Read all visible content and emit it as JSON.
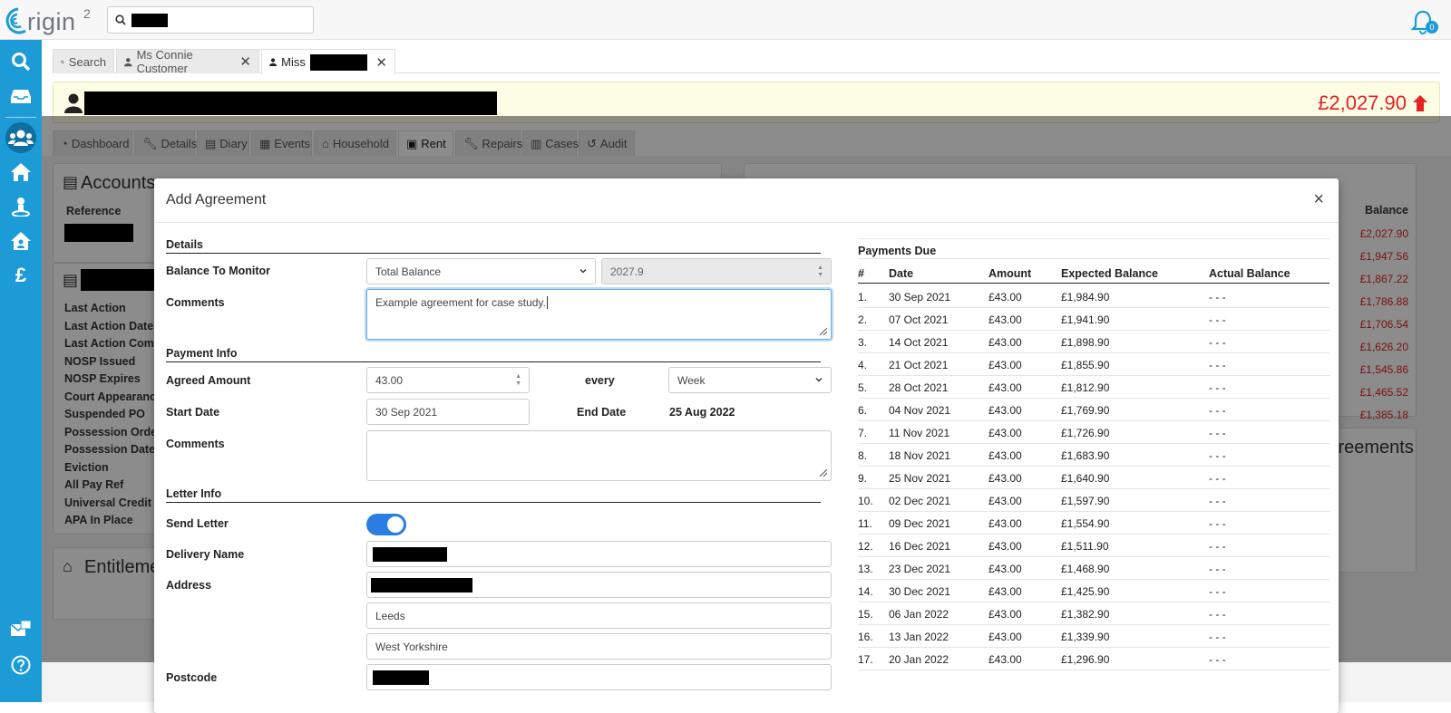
{
  "app": {
    "logo_text": "rigin",
    "logo_sup": "2",
    "notifications_count": "0"
  },
  "tabs": [
    {
      "label": "Search"
    },
    {
      "label": "Ms Connie Customer"
    },
    {
      "label": "Miss"
    }
  ],
  "customer": {
    "balance": "£2,027.90"
  },
  "subtabs": [
    "Dashboard",
    "Details",
    "Diary",
    "Events",
    "Household",
    "Rent",
    "Repairs",
    "Cases",
    "Audit"
  ],
  "background": {
    "accounts_title": "Accounts",
    "reference_label": "Reference",
    "balance_label": "Balance",
    "balances": [
      "£2,027.90",
      "£1,947.56",
      "£1,867.22",
      "£1,786.88",
      "£1,706.54",
      "£1,626.20",
      "£1,545.86",
      "£1,465.52",
      "£1,385.18"
    ],
    "labels": [
      "Last Action",
      "Last Action Date",
      "Last Action Comm",
      "NOSP Issued",
      "NOSP Expires",
      "Court Appearance",
      "Suspended PO",
      "Possession Order",
      "Possession Date",
      "Eviction",
      "All Pay Ref",
      "Universal Credit",
      "APA In Place"
    ],
    "entitlements_title": "Entitleme",
    "agreements_title": "Agreements"
  },
  "modal": {
    "title": "Add Agreement",
    "close": "×",
    "details_heading": "Details",
    "balance_to_monitor_label": "Balance To Monitor",
    "balance_to_monitor_value": "Total Balance",
    "balance_amount": "2027.9",
    "comments_label": "Comments",
    "comments_value": "Example agreement for case study.",
    "payment_info_heading": "Payment Info",
    "agreed_amount_label": "Agreed Amount",
    "agreed_amount_value": "43.00",
    "every_label": "every",
    "frequency_value": "Week",
    "start_date_label": "Start Date",
    "start_date_value": "30 Sep 2021",
    "end_date_label": "End Date",
    "end_date_value": "25 Aug 2022",
    "payment_comments_label": "Comments",
    "payment_comments_value": "",
    "letter_info_heading": "Letter Info",
    "send_letter_label": "Send Letter",
    "send_letter_on": true,
    "delivery_name_label": "Delivery Name",
    "address_label": "Address",
    "address_line3": "Leeds",
    "address_line4": "West Yorkshire",
    "postcode_label": "Postcode"
  },
  "payments": {
    "title": "Payments Due",
    "columns": [
      "#",
      "Date",
      "Amount",
      "Expected Balance",
      "Actual Balance"
    ],
    "rows": [
      [
        "1.",
        "30 Sep 2021",
        "£43.00",
        "£1,984.90",
        "- - -"
      ],
      [
        "2.",
        "07 Oct 2021",
        "£43.00",
        "£1,941.90",
        "- - -"
      ],
      [
        "3.",
        "14 Oct 2021",
        "£43.00",
        "£1,898.90",
        "- - -"
      ],
      [
        "4.",
        "21 Oct 2021",
        "£43.00",
        "£1,855.90",
        "- - -"
      ],
      [
        "5.",
        "28 Oct 2021",
        "£43.00",
        "£1,812.90",
        "- - -"
      ],
      [
        "6.",
        "04 Nov 2021",
        "£43.00",
        "£1,769.90",
        "- - -"
      ],
      [
        "7.",
        "11 Nov 2021",
        "£43.00",
        "£1,726.90",
        "- - -"
      ],
      [
        "8.",
        "18 Nov 2021",
        "£43.00",
        "£1,683.90",
        "- - -"
      ],
      [
        "9.",
        "25 Nov 2021",
        "£43.00",
        "£1,640.90",
        "- - -"
      ],
      [
        "10.",
        "02 Dec 2021",
        "£43.00",
        "£1,597.90",
        "- - -"
      ],
      [
        "11.",
        "09 Dec 2021",
        "£43.00",
        "£1,554.90",
        "- - -"
      ],
      [
        "12.",
        "16 Dec 2021",
        "£43.00",
        "£1,511.90",
        "- - -"
      ],
      [
        "13.",
        "23 Dec 2021",
        "£43.00",
        "£1,468.90",
        "- - -"
      ],
      [
        "14.",
        "30 Dec 2021",
        "£43.00",
        "£1,425.90",
        "- - -"
      ],
      [
        "15.",
        "06 Jan 2022",
        "£43.00",
        "£1,382.90",
        "- - -"
      ],
      [
        "16.",
        "13 Jan 2022",
        "£43.00",
        "£1,339.90",
        "- - -"
      ],
      [
        "17.",
        "20 Jan 2022",
        "£43.00",
        "£1,296.90",
        "- - -"
      ]
    ]
  },
  "colors": {
    "brand": "#1c9bd7",
    "danger": "#e32222",
    "toggle": "#2a7de1"
  }
}
